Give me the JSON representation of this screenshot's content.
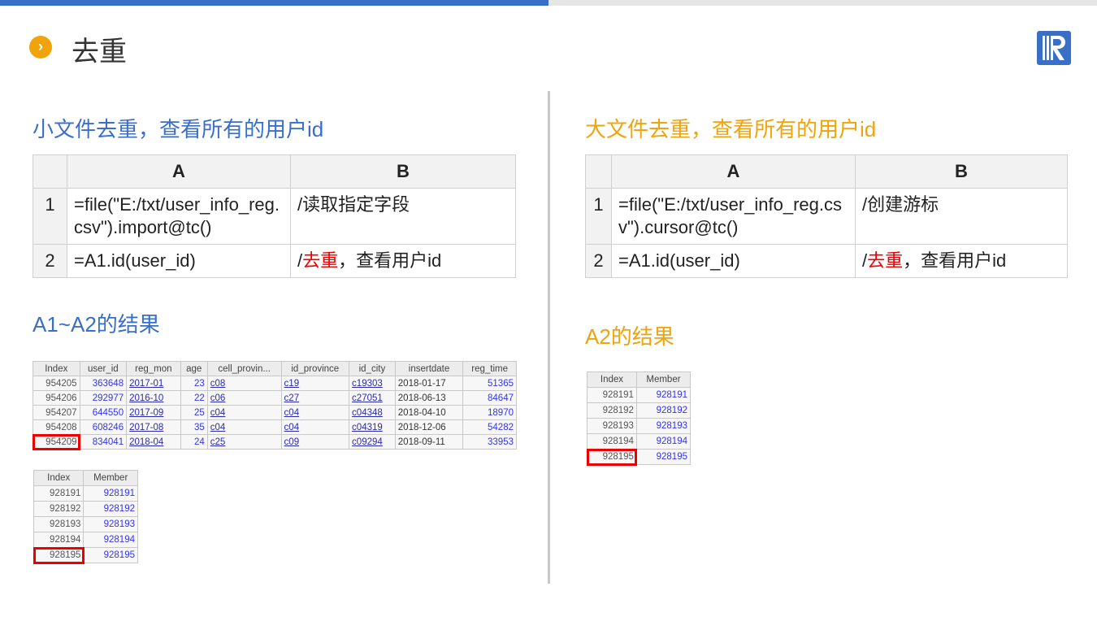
{
  "title": "去重",
  "left": {
    "heading": "小文件去重，查看所有的用户id",
    "code": {
      "cols": [
        "A",
        "B"
      ],
      "rows": [
        {
          "n": "1",
          "a": "=file(\"E:/txt/user_info_reg.csv\").import@tc()",
          "b_pre": "/读取指定字段",
          "b_red": "",
          "b_post": ""
        },
        {
          "n": "2",
          "a": "=A1.id(user_id)",
          "b_pre": "/",
          "b_red": "去重",
          "b_post": "，查看用户id"
        }
      ]
    },
    "result_heading": "A1~A2的结果",
    "data_table": {
      "headers": [
        "Index",
        "user_id",
        "reg_mon",
        "age",
        "cell_provin...",
        "id_province",
        "id_city",
        "insertdate",
        "reg_time"
      ],
      "rows": [
        [
          "954205",
          "363648",
          "2017-01",
          "23",
          "c08",
          "c19",
          "c19303",
          "2018-01-17",
          "51365"
        ],
        [
          "954206",
          "292977",
          "2016-10",
          "22",
          "c06",
          "c27",
          "c27051",
          "2018-06-13",
          "84647"
        ],
        [
          "954207",
          "644550",
          "2017-09",
          "25",
          "c04",
          "c04",
          "c04348",
          "2018-04-10",
          "18970"
        ],
        [
          "954208",
          "608246",
          "2017-08",
          "35",
          "c04",
          "c04",
          "c04319",
          "2018-12-06",
          "54282"
        ],
        [
          "954209",
          "834041",
          "2018-04",
          "24",
          "c25",
          "c09",
          "c09294",
          "2018-09-11",
          "33953"
        ]
      ]
    },
    "member_table": {
      "headers": [
        "Index",
        "Member"
      ],
      "rows": [
        [
          "928191",
          "928191"
        ],
        [
          "928192",
          "928192"
        ],
        [
          "928193",
          "928193"
        ],
        [
          "928194",
          "928194"
        ],
        [
          "928195",
          "928195"
        ]
      ]
    }
  },
  "right": {
    "heading": "大文件去重，查看所有的用户id",
    "code": {
      "cols": [
        "A",
        "B"
      ],
      "rows": [
        {
          "n": "1",
          "a": "=file(\"E:/txt/user_info_reg.csv\").cursor@tc()",
          "b_pre": "/创建游标",
          "b_red": "",
          "b_post": ""
        },
        {
          "n": "2",
          "a": "=A1.id(user_id)",
          "b_pre": "/",
          "b_red": "去重",
          "b_post": "，查看用户id"
        }
      ]
    },
    "result_heading": "A2的结果",
    "member_table": {
      "headers": [
        "Index",
        "Member"
      ],
      "rows": [
        [
          "928191",
          "928191"
        ],
        [
          "928192",
          "928192"
        ],
        [
          "928193",
          "928193"
        ],
        [
          "928194",
          "928194"
        ],
        [
          "928195",
          "928195"
        ]
      ]
    }
  }
}
